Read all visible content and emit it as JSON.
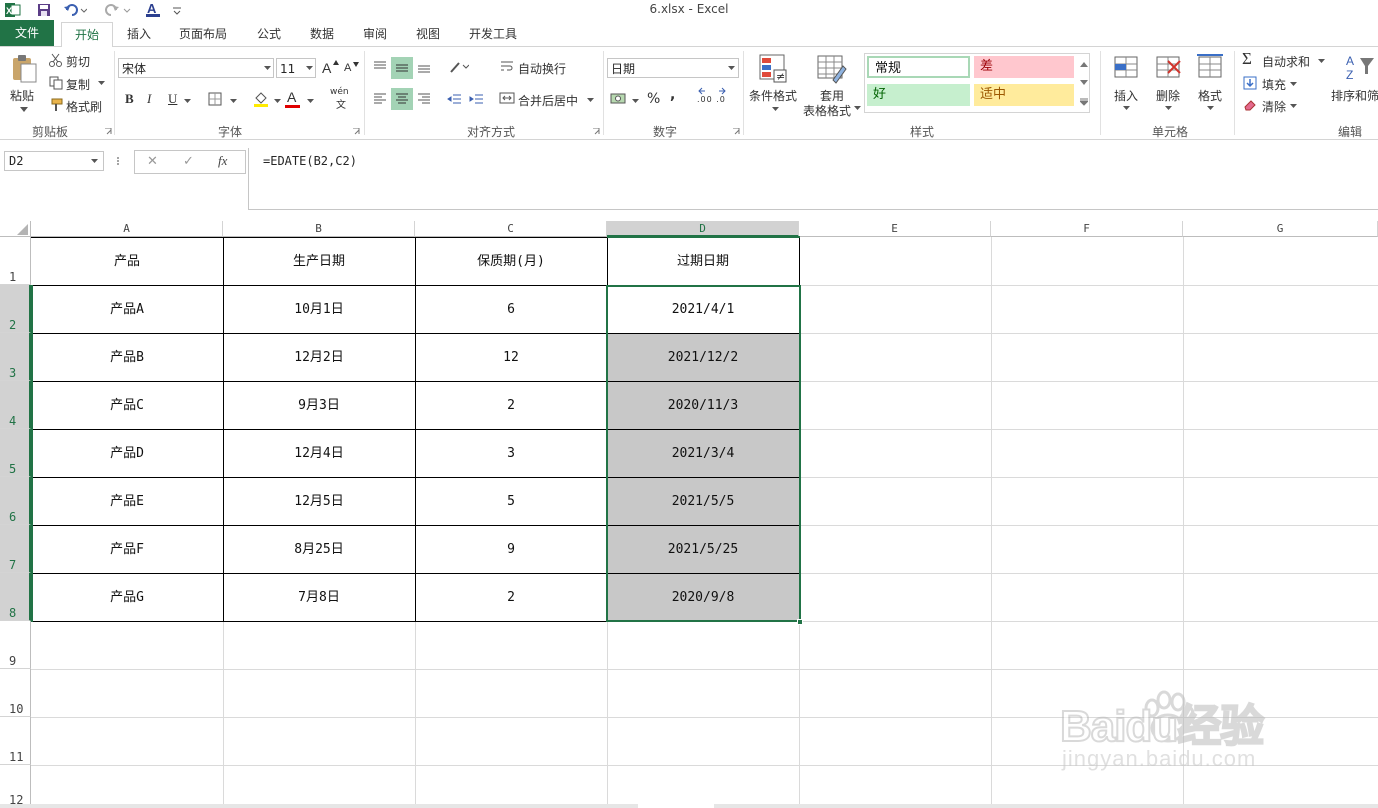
{
  "window": {
    "title": "6.xlsx - Excel"
  },
  "tabs": [
    {
      "label": "文件"
    },
    {
      "label": "开始"
    },
    {
      "label": "插入"
    },
    {
      "label": "页面布局"
    },
    {
      "label": "公式"
    },
    {
      "label": "数据"
    },
    {
      "label": "审阅"
    },
    {
      "label": "视图"
    },
    {
      "label": "开发工具"
    }
  ],
  "ribbon": {
    "clipboard": {
      "paste": "粘贴",
      "cut": "剪切",
      "copy": "复制",
      "format_painter": "格式刷",
      "label": "剪贴板"
    },
    "font": {
      "name": "宋体",
      "size": "11",
      "label": "字体",
      "bold": "B",
      "italic": "I",
      "underline": "U",
      "grow": "A",
      "shrink": "A",
      "font_color": "A",
      "phonetic": "wén"
    },
    "alignment": {
      "wrap": "自动换行",
      "merge": "合并后居中",
      "label": "对齐方式"
    },
    "number": {
      "format": "日期",
      "percent": "%",
      "comma": ",",
      "inc_dec": ".00 .0",
      "label": "数字"
    },
    "styles": {
      "conditional": "条件格式",
      "table_format_1": "套用",
      "table_format_2": "表格格式",
      "normal": "常规",
      "bad": "差",
      "good": "好",
      "neutral": "适中",
      "label": "样式"
    },
    "cells": {
      "insert": "插入",
      "delete": "删除",
      "format": "格式",
      "label": "单元格"
    },
    "editing": {
      "autosum": "自动求和",
      "fill": "填充",
      "clear": "清除",
      "sort": "排序和筛",
      "label": "编辑"
    }
  },
  "formula_bar": {
    "name_box": "D2",
    "formula": "=EDATE(B2,C2)",
    "fx": "fx",
    "cancel": "✕",
    "enter": "✓"
  },
  "columns": [
    "A",
    "B",
    "C",
    "D",
    "E",
    "F",
    "G"
  ],
  "rows": [
    "1",
    "2",
    "3",
    "4",
    "5",
    "6",
    "7",
    "8",
    "9",
    "10",
    "11",
    "12"
  ],
  "table": {
    "headers": [
      "产品",
      "生产日期",
      "保质期(月)",
      "过期日期"
    ],
    "rows": [
      [
        "产品A",
        "10月1日",
        "6",
        "2021/4/1"
      ],
      [
        "产品B",
        "12月2日",
        "12",
        "2021/12/2"
      ],
      [
        "产品C",
        "9月3日",
        "2",
        "2020/11/3"
      ],
      [
        "产品D",
        "12月4日",
        "3",
        "2021/3/4"
      ],
      [
        "产品E",
        "12月5日",
        "5",
        "2021/5/5"
      ],
      [
        "产品F",
        "8月25日",
        "9",
        "2021/5/25"
      ],
      [
        "产品G",
        "7月8日",
        "2",
        "2020/9/8"
      ]
    ]
  },
  "watermark": {
    "brand": "Baidu经验",
    "url": "jingyan.baidu.com"
  },
  "colors": {
    "excel_green": "#217346",
    "selection_fill": "#c8c8c8",
    "bad_fill": "#ffc7ce",
    "good_fill": "#c6efce",
    "neutral_fill": "#ffeb9c"
  }
}
